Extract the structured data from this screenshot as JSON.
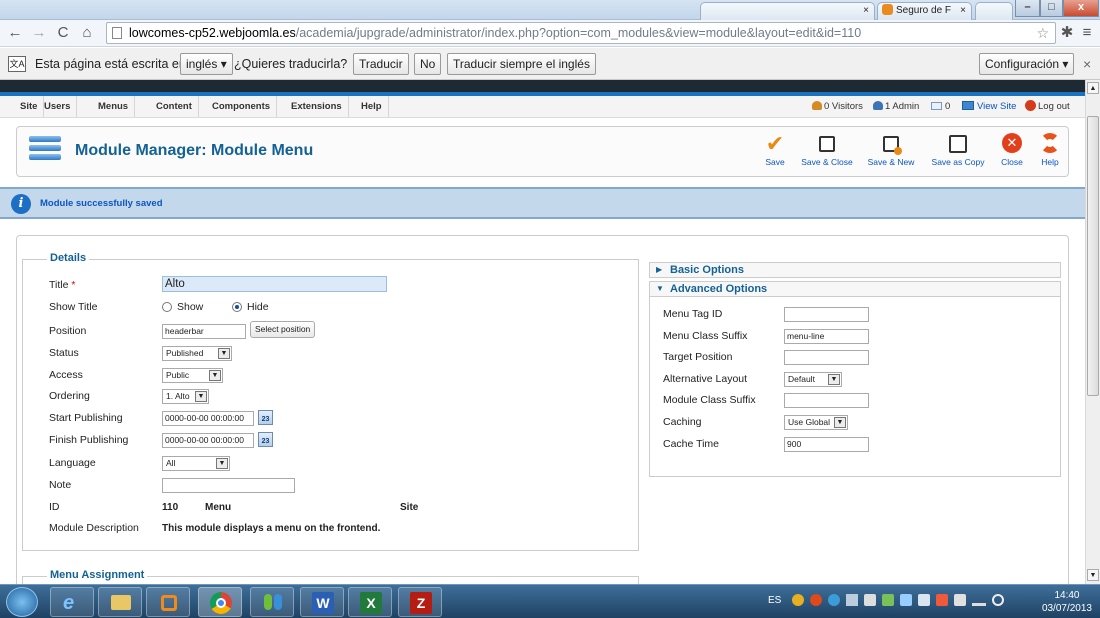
{
  "browser": {
    "tabs": [
      {
        "label": "Seguro de F"
      }
    ],
    "url_domain": "lowcomes-cp52.webjoomla.es",
    "url_rest": "/academia/jupgrade/administrator/index.php?option=com_modules&view=module&layout=edit&id=110",
    "window_buttons": {
      "minimize": "–",
      "maximize": "□",
      "close": "x"
    },
    "translate_bar": {
      "message": "Esta página está escrita en",
      "language": "inglés",
      "question": "¿Quieres traducirla?",
      "translate": "Traducir",
      "no": "No",
      "always": "Traducir siempre el inglés",
      "settings": "Configuración",
      "close": "×"
    }
  },
  "admin_menu": {
    "items": [
      "Site",
      "Users",
      "Menus",
      "Content",
      "Components",
      "Extensions",
      "Help"
    ],
    "status": {
      "visitors": "0 Visitors",
      "admin": "1 Admin",
      "messages": "0",
      "view_site": "View Site",
      "logout": "Log out"
    }
  },
  "toolbar": {
    "title": "Module Manager: Module Menu",
    "buttons": [
      "Save",
      "Save & Close",
      "Save & New",
      "Save as Copy",
      "Close",
      "Help"
    ]
  },
  "message": "Module successfully saved",
  "details": {
    "legend": "Details",
    "title_label": "Title",
    "required_mark": "*",
    "title_value": "Alto",
    "show_title_label": "Show Title",
    "show_option": "Show",
    "hide_option": "Hide",
    "position_label": "Position",
    "position_value": "headerbar",
    "select_position": "Select position",
    "status_label": "Status",
    "status_value": "Published",
    "access_label": "Access",
    "access_value": "Public",
    "ordering_label": "Ordering",
    "ordering_value": "1. Alto",
    "start_label": "Start Publishing",
    "start_value": "0000-00-00 00:00:00",
    "finish_label": "Finish Publishing",
    "finish_value": "0000-00-00 00:00:00",
    "calendar_text": "23",
    "language_label": "Language",
    "language_value": "All",
    "note_label": "Note",
    "note_value": "",
    "id_label": "ID",
    "id_value": "110",
    "id_type": "Menu",
    "id_client": "Site",
    "desc_label": "Module Description",
    "desc_value": "This module displays a menu on the frontend."
  },
  "menu_assignment": {
    "legend": "Menu Assignment"
  },
  "options": {
    "basic_title": "Basic Options",
    "advanced_title": "Advanced Options",
    "menu_tag_id_label": "Menu Tag ID",
    "menu_tag_id_value": "",
    "menu_class_suffix_label": "Menu Class Suffix",
    "menu_class_suffix_value": "menu-line",
    "target_position_label": "Target Position",
    "target_position_value": "",
    "alt_layout_label": "Alternative Layout",
    "alt_layout_value": "Default",
    "module_class_suffix_label": "Module Class Suffix",
    "module_class_suffix_value": "",
    "caching_label": "Caching",
    "caching_value": "Use Global",
    "cache_time_label": "Cache Time",
    "cache_time_value": "900"
  },
  "taskbar": {
    "lang": "ES",
    "time": "14:40",
    "date": "03/07/2013"
  },
  "colors": {
    "joomla_blue": "#146295",
    "toolbar_link": "#0b55c4",
    "message_bg": "#c4d8ec",
    "close_red": "#e2401c"
  }
}
